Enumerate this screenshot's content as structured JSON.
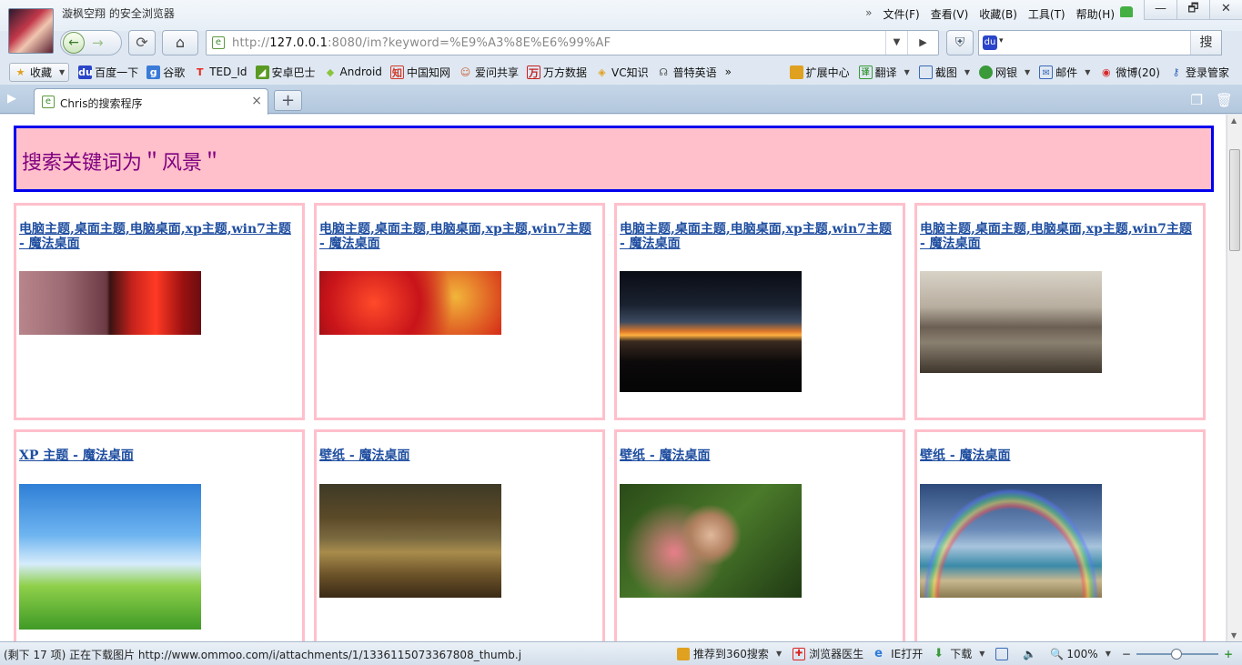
{
  "window": {
    "title": "漩枫空翔 的安全浏览器",
    "menu": [
      "文件(F)",
      "查看(V)",
      "收藏(B)",
      "工具(T)",
      "帮助(H)"
    ],
    "menu_arrow": "»",
    "controls": [
      "—",
      "🗗",
      "✕"
    ]
  },
  "nav": {
    "back": "←",
    "forward": "→",
    "reload": "⟳",
    "home": "⌂",
    "url_host": "127.0.0.1",
    "url_prefix": "http://",
    "url_suffix": ":8080/im?keyword=%E9%A3%8E%E6%99%AF",
    "dropdown": "▼",
    "go": "▶",
    "shield": "⛨",
    "search_button": "搜"
  },
  "bookmarks": {
    "favorites": "收藏",
    "items": [
      {
        "label": "百度一下",
        "icon": "baidu-icon",
        "color": "#2b45c8"
      },
      {
        "label": "谷歌",
        "icon": "google-icon",
        "color": "#3b7bd8"
      },
      {
        "label": "TED_Id",
        "icon": "ted-icon",
        "color": "#e62b1e"
      },
      {
        "label": "安卓巴士",
        "icon": "android-bus-icon",
        "color": "#5a9a22"
      },
      {
        "label": "Android",
        "icon": "android-icon",
        "color": "#8ac43f"
      },
      {
        "label": "中国知网",
        "icon": "cnki-icon",
        "color": "#d23a2a"
      },
      {
        "label": "爱问共享",
        "icon": "iask-icon",
        "color": "#c65a2a"
      },
      {
        "label": "万方数据",
        "icon": "wanfang-icon",
        "color": "#c82020"
      },
      {
        "label": "VC知识",
        "icon": "vc-icon",
        "color": "#e0a020"
      },
      {
        "label": "普特英语",
        "icon": "putclub-icon",
        "color": "#555555"
      }
    ],
    "more": "»",
    "right": [
      {
        "label": "扩展中心",
        "icon": "extension-icon",
        "color": "#e0a020"
      },
      {
        "label": "翻译",
        "icon": "translate-icon",
        "color": "#3a9a3a"
      },
      {
        "label": "截图",
        "icon": "screenshot-icon",
        "color": "#3a6ab8"
      },
      {
        "label": "网银",
        "icon": "ebank-icon",
        "color": "#3a9a3a"
      },
      {
        "label": "邮件",
        "icon": "mail-icon",
        "color": "#3a6ab8"
      },
      {
        "label": "微博(20)",
        "icon": "weibo-icon",
        "color": "#d8282a"
      },
      {
        "label": "登录管家",
        "icon": "key-icon",
        "color": "#3a6ab8"
      }
    ]
  },
  "tabs": {
    "active_label": "Chris的搜索程序",
    "close": "×",
    "new": "+"
  },
  "page": {
    "banner": "搜索关键词为＂风景＂",
    "results": [
      {
        "title": "电脑主题,桌面主题,电脑桌面,xp主题,win7主题 - 魔法桌面",
        "image": "autumn-blossom-image"
      },
      {
        "title": "电脑主题,桌面主题,电脑桌面,xp主题,win7主题 - 魔法桌面",
        "image": "red-leaves-image"
      },
      {
        "title": "电脑主题,桌面主题,电脑桌面,xp主题,win7主题 - 魔法桌面",
        "image": "sunset-silhouette-image"
      },
      {
        "title": "电脑主题,桌面主题,电脑桌面,xp主题,win7主题 - 魔法桌面",
        "image": "tower-bridge-image"
      },
      {
        "title": "XP 主题 - 魔法桌面",
        "image": "grass-sky-desktop-image"
      },
      {
        "title": "壁纸 - 魔法桌面",
        "image": "railway-image"
      },
      {
        "title": "壁纸 - 魔法桌面",
        "image": "flower-bud-image"
      },
      {
        "title": "壁纸 - 魔法桌面",
        "image": "rainbow-beach-image"
      }
    ]
  },
  "status": {
    "text": "(剩下 17 项) 正在下载图片 http://www.ommoo.com/i/attachments/1/1336115073367808_thumb.j",
    "recommend": "推荐到360搜索",
    "doctor": "浏览器医生",
    "ie": "IE打开",
    "download": "下载",
    "zoom": "100%",
    "zoom_minus": "−",
    "zoom_plus": "+"
  }
}
